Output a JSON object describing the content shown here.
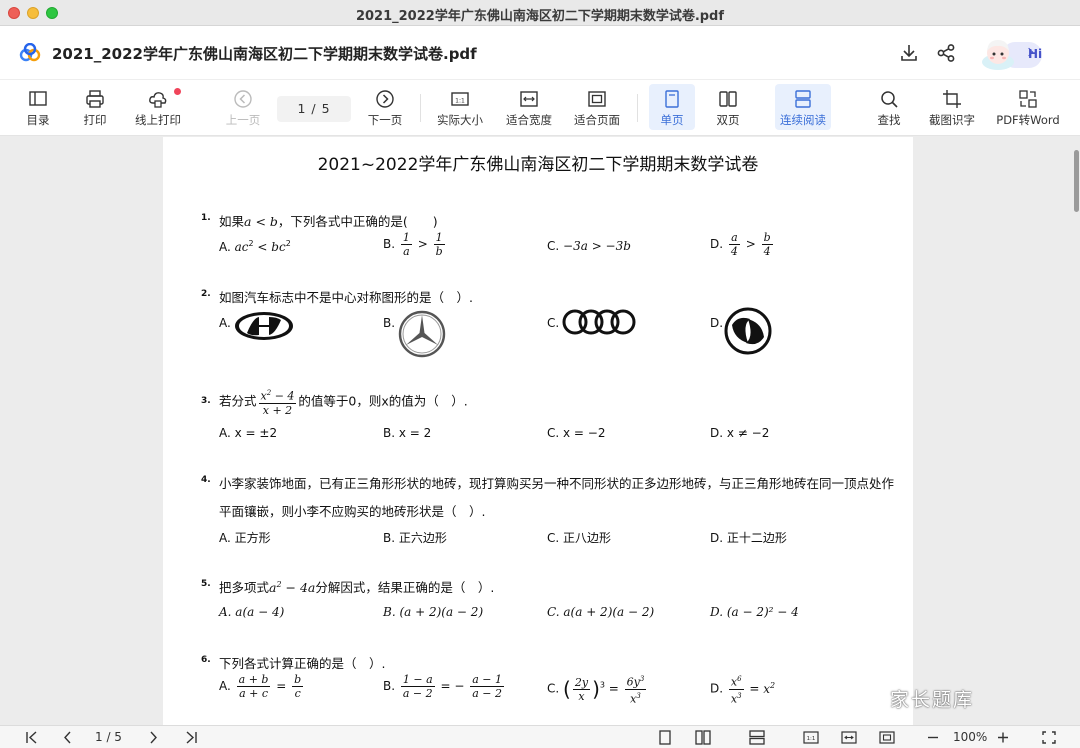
{
  "window": {
    "title": "2021_2022学年广东佛山南海区初二下学期期末数学试卷.pdf"
  },
  "header": {
    "doc_title": "2021_2022学年广东佛山南海区初二下学期期末数学试卷.pdf",
    "hi_label": "Hi"
  },
  "toolbar": {
    "items": [
      {
        "label": "目录",
        "icon": "toc-icon"
      },
      {
        "label": "打印",
        "icon": "print-icon"
      },
      {
        "label": "线上打印",
        "icon": "cloud-print-icon"
      },
      {
        "label": "上一页",
        "icon": "prev-page-icon"
      },
      {
        "label": "下一页",
        "icon": "next-page-icon"
      },
      {
        "label": "实际大小",
        "icon": "actual-size-icon"
      },
      {
        "label": "适合宽度",
        "icon": "fit-width-icon"
      },
      {
        "label": "适合页面",
        "icon": "fit-page-icon"
      },
      {
        "label": "单页",
        "icon": "single-page-icon"
      },
      {
        "label": "双页",
        "icon": "double-page-icon"
      },
      {
        "label": "连续阅读",
        "icon": "continuous-icon"
      },
      {
        "label": "查找",
        "icon": "search-icon"
      },
      {
        "label": "截图识字",
        "icon": "screenshot-ocr-icon"
      },
      {
        "label": "PDF转Word",
        "icon": "pdf-to-word-icon"
      }
    ],
    "page_indicator": "1 / 5"
  },
  "paper": {
    "title": "2021~2022学年广东佛山南海区初二下学期期末数学试卷",
    "questions": [
      {
        "num": "1.",
        "text_a": "如果",
        "text_b": "，下列各式中正确的是(　　)",
        "math": "a < b",
        "options": [
          "A.",
          "B.",
          "C.",
          "D."
        ]
      },
      {
        "num": "2.",
        "text": "如图汽车标志中不是中心对称图形的是（　）.",
        "options": [
          "A.",
          "B.",
          "C.",
          "D."
        ]
      },
      {
        "num": "3.",
        "text_a": "若分式",
        "text_b": "的值等于0，则x的值为（　）.",
        "options": [
          "A. x = ±2",
          "B. x = 2",
          "C. x = −2",
          "D. x ≠ −2"
        ]
      },
      {
        "num": "4.",
        "text_line1": "小李家装饰地面，已有正三角形形状的地砖，现打算购买另一种不同形状的正多边形地砖，与正三角形地砖在同一顶点处作",
        "text_line2": "平面镶嵌，则小李不应购买的地砖形状是（　）.",
        "options": [
          "A. 正方形",
          "B. 正六边形",
          "C. 正八边形",
          "D. 正十二边形"
        ]
      },
      {
        "num": "5.",
        "text_a": "把多项式",
        "text_b": "分解因式，结果正确的是（　）.",
        "options": [
          "A. a(a − 4)",
          "B. (a + 2)(a − 2)",
          "C. a(a + 2)(a − 2)",
          "D. (a − 2)² − 4"
        ]
      },
      {
        "num": "6.",
        "text": "下列各式计算正确的是（　）.",
        "options": [
          "A.",
          "B.",
          "C.",
          "D."
        ]
      }
    ]
  },
  "bottombar": {
    "page_indicator": "1 / 5",
    "zoom": "100%"
  },
  "watermark": "家长题库"
}
